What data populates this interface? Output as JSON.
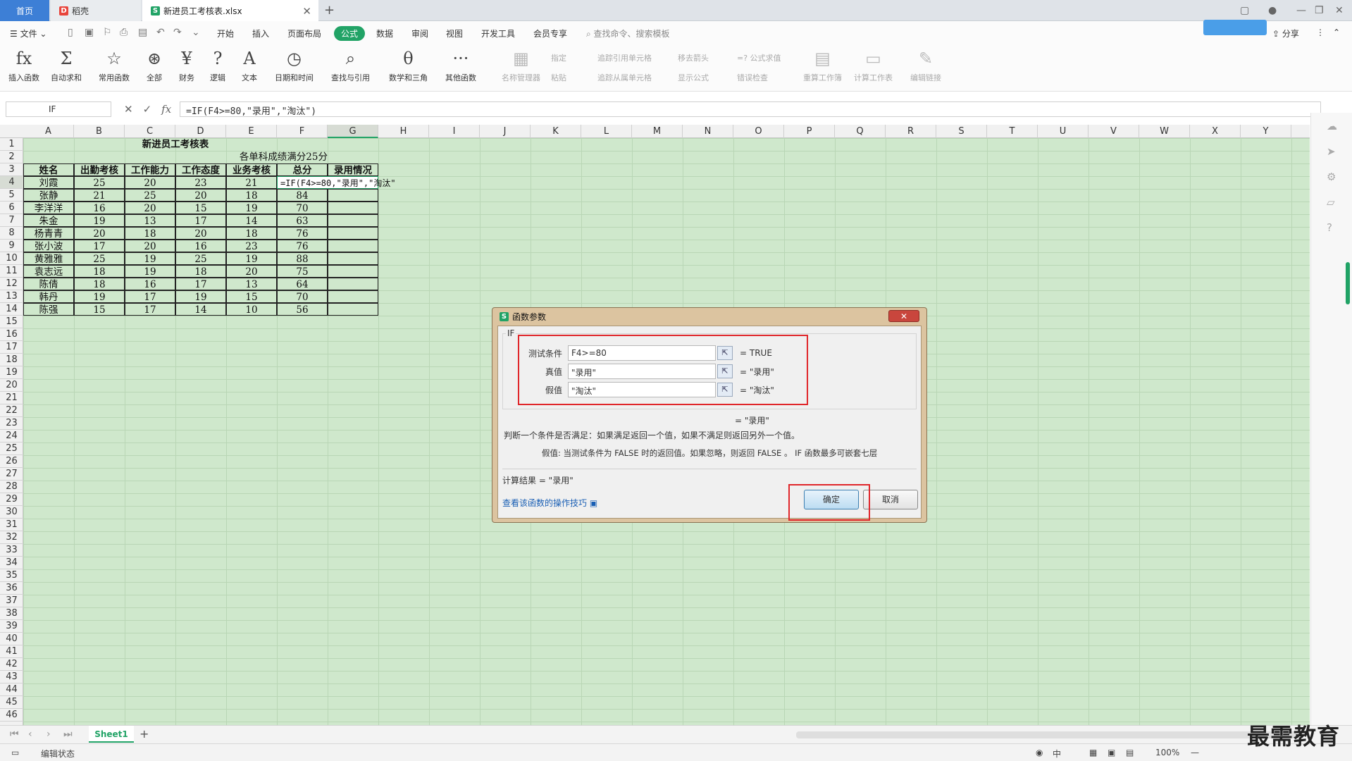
{
  "titlebar": {
    "home": "首页",
    "tab_dk": "稻壳",
    "tab_file": "新进员工考核表.xlsx",
    "new_tab": "+"
  },
  "menubar": {
    "file": "文件",
    "items": [
      "开始",
      "插入",
      "页面布局",
      "公式",
      "数据",
      "审阅",
      "视图",
      "开发工具",
      "会员专享"
    ],
    "active": "公式",
    "search": "查找命令、搜索模板",
    "share": "分享"
  },
  "ribbon": {
    "buttons": [
      "插入函数",
      "自动求和",
      "常用函数",
      "全部",
      "财务",
      "逻辑",
      "文本",
      "日期和时间",
      "查找与引用",
      "数学和三角",
      "其他函数",
      "名称管理器",
      "重算工作簿",
      "计算工作表",
      "编辑链接"
    ],
    "small": [
      "指定",
      "粘贴",
      "追踪引用单元格",
      "追踪从属单元格",
      "移去箭头",
      "显示公式",
      "=? 公式求值",
      "错误检查"
    ]
  },
  "formula_bar": {
    "name_box": "IF",
    "formula": "=IF(F4>=80,\"录用\",\"淘汰\")"
  },
  "grid": {
    "columns": [
      "A",
      "B",
      "C",
      "D",
      "E",
      "F",
      "G",
      "H",
      "I",
      "J",
      "K",
      "L",
      "M",
      "N",
      "O",
      "P",
      "Q",
      "R",
      "S",
      "T",
      "U",
      "V",
      "W",
      "X",
      "Y"
    ],
    "row_count": 46,
    "title": "新进员工考核表",
    "note": "各单科成绩满分25分",
    "headers": [
      "姓名",
      "出勤考核",
      "工作能力",
      "工作态度",
      "业务考核",
      "总分",
      "录用情况"
    ],
    "rows": [
      [
        "刘霞",
        "25",
        "20",
        "23",
        "21",
        ""
      ],
      [
        "张静",
        "21",
        "25",
        "20",
        "18",
        "84"
      ],
      [
        "李洋洋",
        "16",
        "20",
        "15",
        "19",
        "70"
      ],
      [
        "朱金",
        "19",
        "13",
        "17",
        "14",
        "63"
      ],
      [
        "杨青青",
        "20",
        "18",
        "20",
        "18",
        "76"
      ],
      [
        "张小波",
        "17",
        "20",
        "16",
        "23",
        "76"
      ],
      [
        "黄雅雅",
        "25",
        "19",
        "25",
        "19",
        "88"
      ],
      [
        "袁志远",
        "18",
        "19",
        "18",
        "20",
        "75"
      ],
      [
        "陈倩",
        "18",
        "16",
        "17",
        "13",
        "64"
      ],
      [
        "韩丹",
        "19",
        "17",
        "19",
        "15",
        "70"
      ],
      [
        "陈强",
        "15",
        "17",
        "14",
        "10",
        "56"
      ]
    ],
    "editing_cell_text": "=IF(F4>=80,\"录用\",\"淘汰\""
  },
  "dialog": {
    "title": "函数参数",
    "close": "✕",
    "function": "IF",
    "args": [
      {
        "label": "测试条件",
        "value": "F4>=80",
        "result": "= TRUE"
      },
      {
        "label": "真值",
        "value": "\"录用\"",
        "result": "= \"录用\""
      },
      {
        "label": "假值",
        "value": "\"淘汰\"",
        "result": "= \"淘汰\""
      }
    ],
    "overall": "= \"录用\"",
    "desc": "判断一个条件是否满足：如果满足返回一个值，如果不满足则返回另外一个值。",
    "arg_desc": "假值:  当测试条件为 FALSE 时的返回值。如果忽略，则返回 FALSE 。 IF 函数最多可嵌套七层",
    "calc_result": "计算结果 = \"录用\"",
    "help_link": "查看该函数的操作技巧",
    "ok": "确定",
    "cancel": "取消"
  },
  "sheetbar": {
    "sheet": "Sheet1",
    "add": "+"
  },
  "status": {
    "mode": "编辑状态",
    "zoom": "100%"
  },
  "watermark": "最需教育",
  "colors": {
    "accent": "#21a366",
    "grid_bg": "#cfe8cc",
    "highlight": "#e0262a"
  }
}
